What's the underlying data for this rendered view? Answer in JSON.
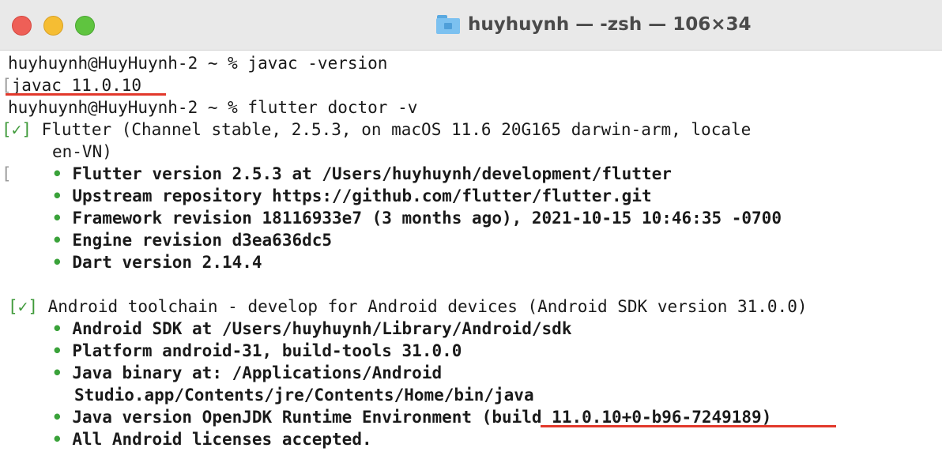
{
  "window": {
    "title": "huyhuynh — -zsh — 106×34",
    "folder_icon": "home-folder-icon"
  },
  "colors": {
    "accent_underline": "#e2382b",
    "check_green": "#3f9a3a",
    "bullet_green": "#3aa23a"
  },
  "terminal": {
    "line1": "huyhuynh@HuyHuynh-2 ~ % javac -version",
    "line2_bracket": "[",
    "line2_text": "javac 11.0.10",
    "line3": "huyhuynh@HuyHuynh-2 ~ % flutter doctor -v",
    "flutter": {
      "open": "[",
      "mark": "✓",
      "close": "]",
      "head": " Flutter (Channel stable, 2.5.3, on macOS 11.6 20G165 darwin-arm, locale",
      "head_cont": "en-VN)",
      "bracket_stub": "[",
      "bullet": "•",
      "items": [
        "Flutter version 2.5.3 at /Users/huyhuynh/development/flutter",
        "Upstream repository https://github.com/flutter/flutter.git",
        "Framework revision 18116933e7 (3 months ago), 2021-10-15 10:46:35 -0700",
        "Engine revision d3ea636dc5",
        "Dart version 2.14.4"
      ]
    },
    "android": {
      "open": "[",
      "mark": "✓",
      "close": "]",
      "head": " Android toolchain - develop for Android devices (Android SDK version 31.0.0)",
      "items": [
        "Android SDK at /Users/huyhuynh/Library/Android/sdk",
        "Platform android-31, build-tools 31.0.0",
        "Java binary at: /Applications/Android",
        "Java version OpenJDK Runtime Environment (",
        "All Android licenses accepted."
      ],
      "java_binary_cont": "Studio.app/Contents/jre/Contents/Home/bin/java",
      "java_build": "build 11.0.10+0-b96-7249189",
      "java_close": ")"
    }
  }
}
